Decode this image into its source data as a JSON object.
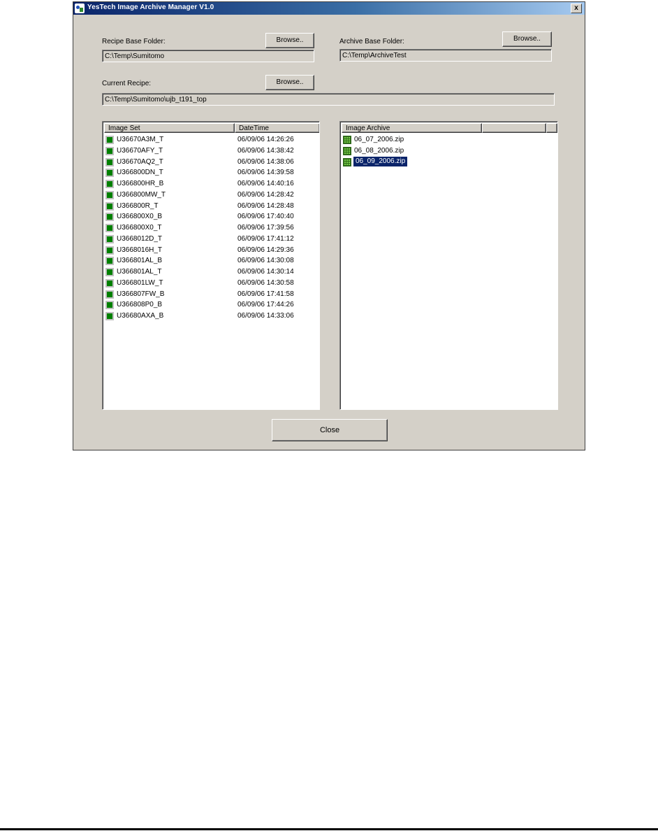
{
  "window": {
    "title": "YesTech Image Archive Manager V1.0",
    "close_glyph": "x"
  },
  "recipe_base": {
    "label": "Recipe Base Folder:",
    "path": "C:\\Temp\\Sumitomo",
    "browse_label": "Browse.."
  },
  "archive_base": {
    "label": "Archive Base Folder:",
    "path": "C:\\Temp\\ArchiveTest",
    "browse_label": "Browse.."
  },
  "current_recipe": {
    "label": "Current Recipe:",
    "path": "C:\\Temp\\Sumitomo\\ujb_t191_top",
    "browse_label": "Browse.."
  },
  "image_set_list": {
    "columns": [
      "Image Set",
      "DateTime",
      ""
    ],
    "rows": [
      {
        "name": "U36670A3M_T",
        "datetime": "06/09/06 14:26:26"
      },
      {
        "name": "U36670AFY_T",
        "datetime": "06/09/06 14:38:42"
      },
      {
        "name": "U36670AQ2_T",
        "datetime": "06/09/06 14:38:06"
      },
      {
        "name": "U366800DN_T",
        "datetime": "06/09/06 14:39:58"
      },
      {
        "name": "U366800HR_B",
        "datetime": "06/09/06 14:40:16"
      },
      {
        "name": "U366800MW_T",
        "datetime": "06/09/06 14:28:42"
      },
      {
        "name": "U366800R_T",
        "datetime": "06/09/06 14:28:48"
      },
      {
        "name": "U366800X0_B",
        "datetime": "06/09/06 17:40:40"
      },
      {
        "name": "U366800X0_T",
        "datetime": "06/09/06 17:39:56"
      },
      {
        "name": "U3668012D_T",
        "datetime": "06/09/06 17:41:12"
      },
      {
        "name": "U3668016H_T",
        "datetime": "06/09/06 14:29:36"
      },
      {
        "name": "U366801AL_B",
        "datetime": "06/09/06 14:30:08"
      },
      {
        "name": "U366801AL_T",
        "datetime": "06/09/06 14:30:14"
      },
      {
        "name": "U366801LW_T",
        "datetime": "06/09/06 14:30:58"
      },
      {
        "name": "U366807FW_B",
        "datetime": "06/09/06 17:41:58"
      },
      {
        "name": "U366808P0_B",
        "datetime": "06/09/06 17:44:26"
      },
      {
        "name": "U36680AXA_B",
        "datetime": "06/09/06 14:33:06"
      }
    ]
  },
  "archive_list": {
    "columns": [
      "Image Archive",
      "",
      ""
    ],
    "rows": [
      {
        "name": "06_07_2006.zip",
        "selected": false
      },
      {
        "name": "06_08_2006.zip",
        "selected": false
      },
      {
        "name": "06_09_2006.zip",
        "selected": true
      }
    ]
  },
  "close_button": {
    "label": "Close"
  },
  "colors": {
    "dialog_bg": "#d4d0c8",
    "titlebar_start": "#0a246a",
    "titlebar_end": "#a6caf0",
    "selection": "#0a246a",
    "image_set_icon": "#008000"
  }
}
